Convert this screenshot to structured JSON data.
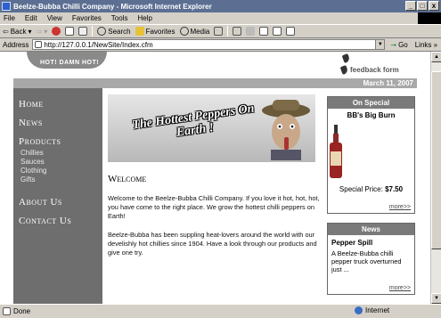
{
  "window": {
    "title": "Beelze-Bubba Chilli Company - Microsoft Internet Explorer",
    "min": "_",
    "max": "□",
    "close": "x"
  },
  "menu": [
    "File",
    "Edit",
    "View",
    "Favorites",
    "Tools",
    "Help"
  ],
  "toolbar": {
    "back": "Back",
    "search": "Search",
    "favorites": "Favorites",
    "media": "Media"
  },
  "address": {
    "label": "Address",
    "url": "http://127.0.0.1/NewSite/Index.cfm",
    "go": "Go",
    "links": "Links"
  },
  "page": {
    "logo_tagline": "HOT! DAMN HOT!",
    "feedback": "feedback form",
    "date": "March 11, 2007",
    "nav": [
      {
        "label": "Home"
      },
      {
        "label": "News"
      },
      {
        "label": "Products"
      },
      {
        "label": "About Us"
      },
      {
        "label": "Contact Us"
      }
    ],
    "subnav": [
      "Chillies",
      "Sauces",
      "Clothing",
      "Gifts"
    ],
    "banner": "The Hottest Peppers On Earth !",
    "welcome_heading": "Welcome",
    "para1": "Welcome to the Beelze-Bubba Chilli Company. If you love it hot, hot, hot, you have come to the right place. We grow the hottest chilli peppers on Earth!",
    "para2": "Beelze-Bubba has been suppling heat-lovers around the world with our develishly hot chillies since 1904. Have a look through our products and give one try.",
    "special": {
      "heading": "On Special",
      "product": "BB's Big Burn",
      "price_label": "Special Price:",
      "price": "$7.50",
      "more": "more>>"
    },
    "news": {
      "heading": "News",
      "title": "Pepper Spill",
      "text": "A Beelze-Bubba chilli pepper truck overturned just ...",
      "more": "more>>"
    }
  },
  "status": {
    "text": "Done",
    "zone": "Internet"
  },
  "colors": {
    "titlebar": "#5c6f93",
    "sidebar": "#6e6e6e",
    "chrome": "#d4d0c8"
  }
}
